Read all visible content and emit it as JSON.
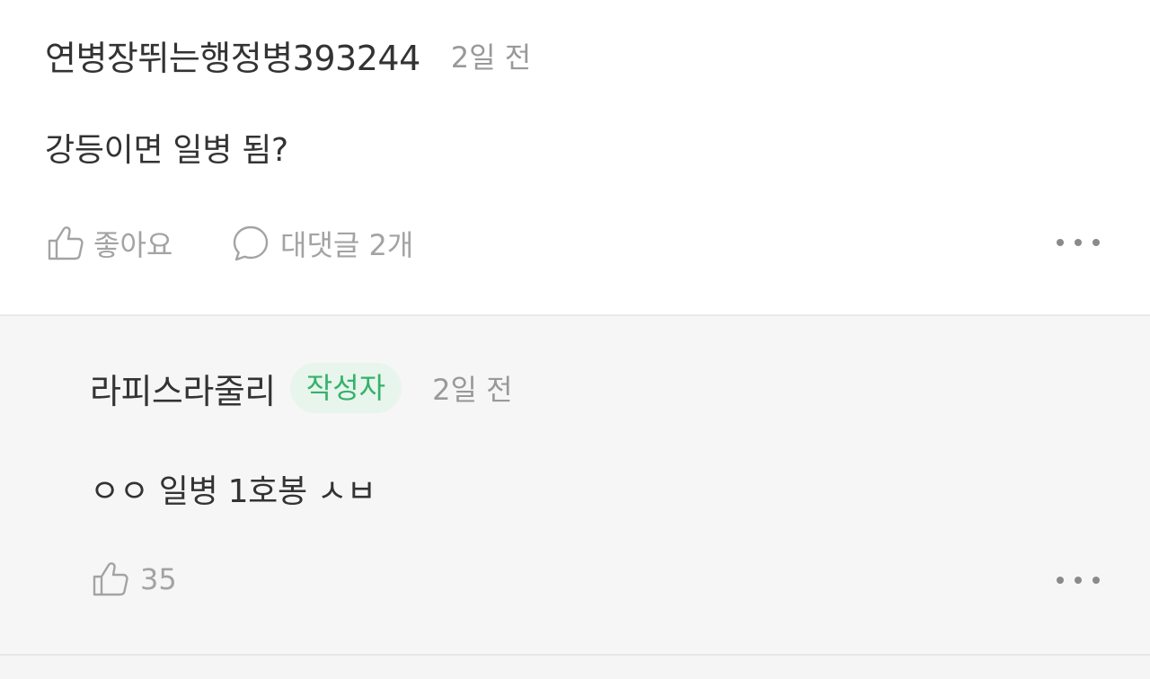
{
  "comment": {
    "author": "연병장뛰는행정병393244",
    "time": "2일 전",
    "text": "강등이면 일병 됨?",
    "like_label": "좋아요",
    "reply_label": "대댓글 2개"
  },
  "reply": {
    "author": "라피스라줄리",
    "badge": "작성자",
    "time": "2일 전",
    "text": "ㅇㅇ 일병 1호봉 ㅅㅂ",
    "like_count": "35"
  },
  "colors": {
    "badge_text": "#35b26b",
    "badge_bg": "#e8f5ec",
    "icon": "#a3a3a3"
  },
  "icons": {
    "like": "thumbs-up-icon",
    "reply": "speech-bubble-icon",
    "more": "more-dots-icon"
  }
}
